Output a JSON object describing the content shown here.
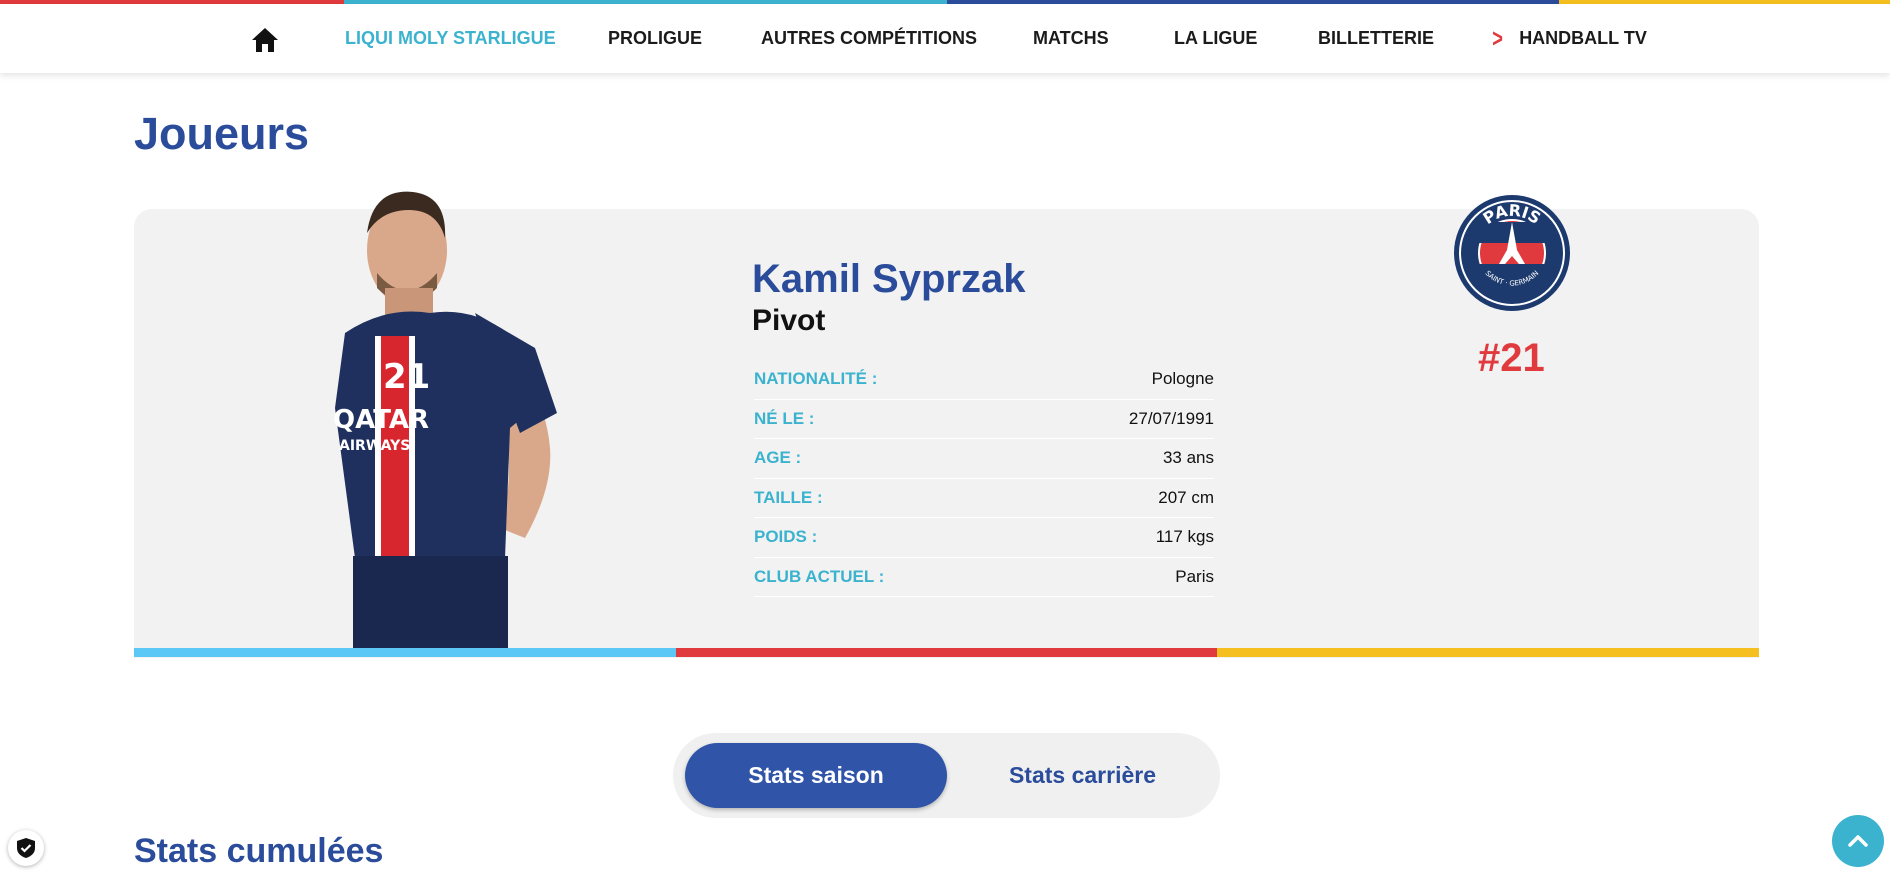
{
  "colors": {
    "brand_blue": "#2a4c9b",
    "accent_cyan": "#3bb3cf",
    "accent_red": "#e03a3e",
    "accent_yellow": "#f5bf1f",
    "light_blue": "#5bc8f5",
    "psg_navy": "#1c3a6e"
  },
  "nav": {
    "home_icon": "home-icon",
    "items": [
      {
        "label": "LIQUI MOLY STARLIGUE",
        "active": true
      },
      {
        "label": "PROLIGUE"
      },
      {
        "label": "AUTRES COMPÉTITIONS"
      },
      {
        "label": "MATCHS"
      },
      {
        "label": "LA LIGUE"
      },
      {
        "label": "BILLETTERIE"
      },
      {
        "label": "HANDBALL TV",
        "icon": "chevron-right-icon"
      }
    ]
  },
  "page": {
    "title": "Joueurs"
  },
  "player": {
    "name": "Kamil Syprzak",
    "position": "Pivot",
    "number": "#21",
    "club_logo_text": {
      "top": "PARIS",
      "bottom": "SAINT · GERMAIN"
    },
    "shirt_sponsor": "QATAR AIRWAYS",
    "info": [
      {
        "label": "NATIONALITÉ :",
        "value": "Pologne"
      },
      {
        "label": "NÉ LE :",
        "value": "27/07/1991"
      },
      {
        "label": "AGE :",
        "value": "33 ans"
      },
      {
        "label": "TAILLE :",
        "value": "207 cm"
      },
      {
        "label": "POIDS :",
        "value": "117 kgs"
      },
      {
        "label": "CLUB ACTUEL :",
        "value": "Paris"
      }
    ]
  },
  "stats_toggle": {
    "season_label": "Stats saison",
    "career_label": "Stats carrière",
    "selected": "Stats saison"
  },
  "stats": {
    "section_title": "Stats cumulées"
  }
}
